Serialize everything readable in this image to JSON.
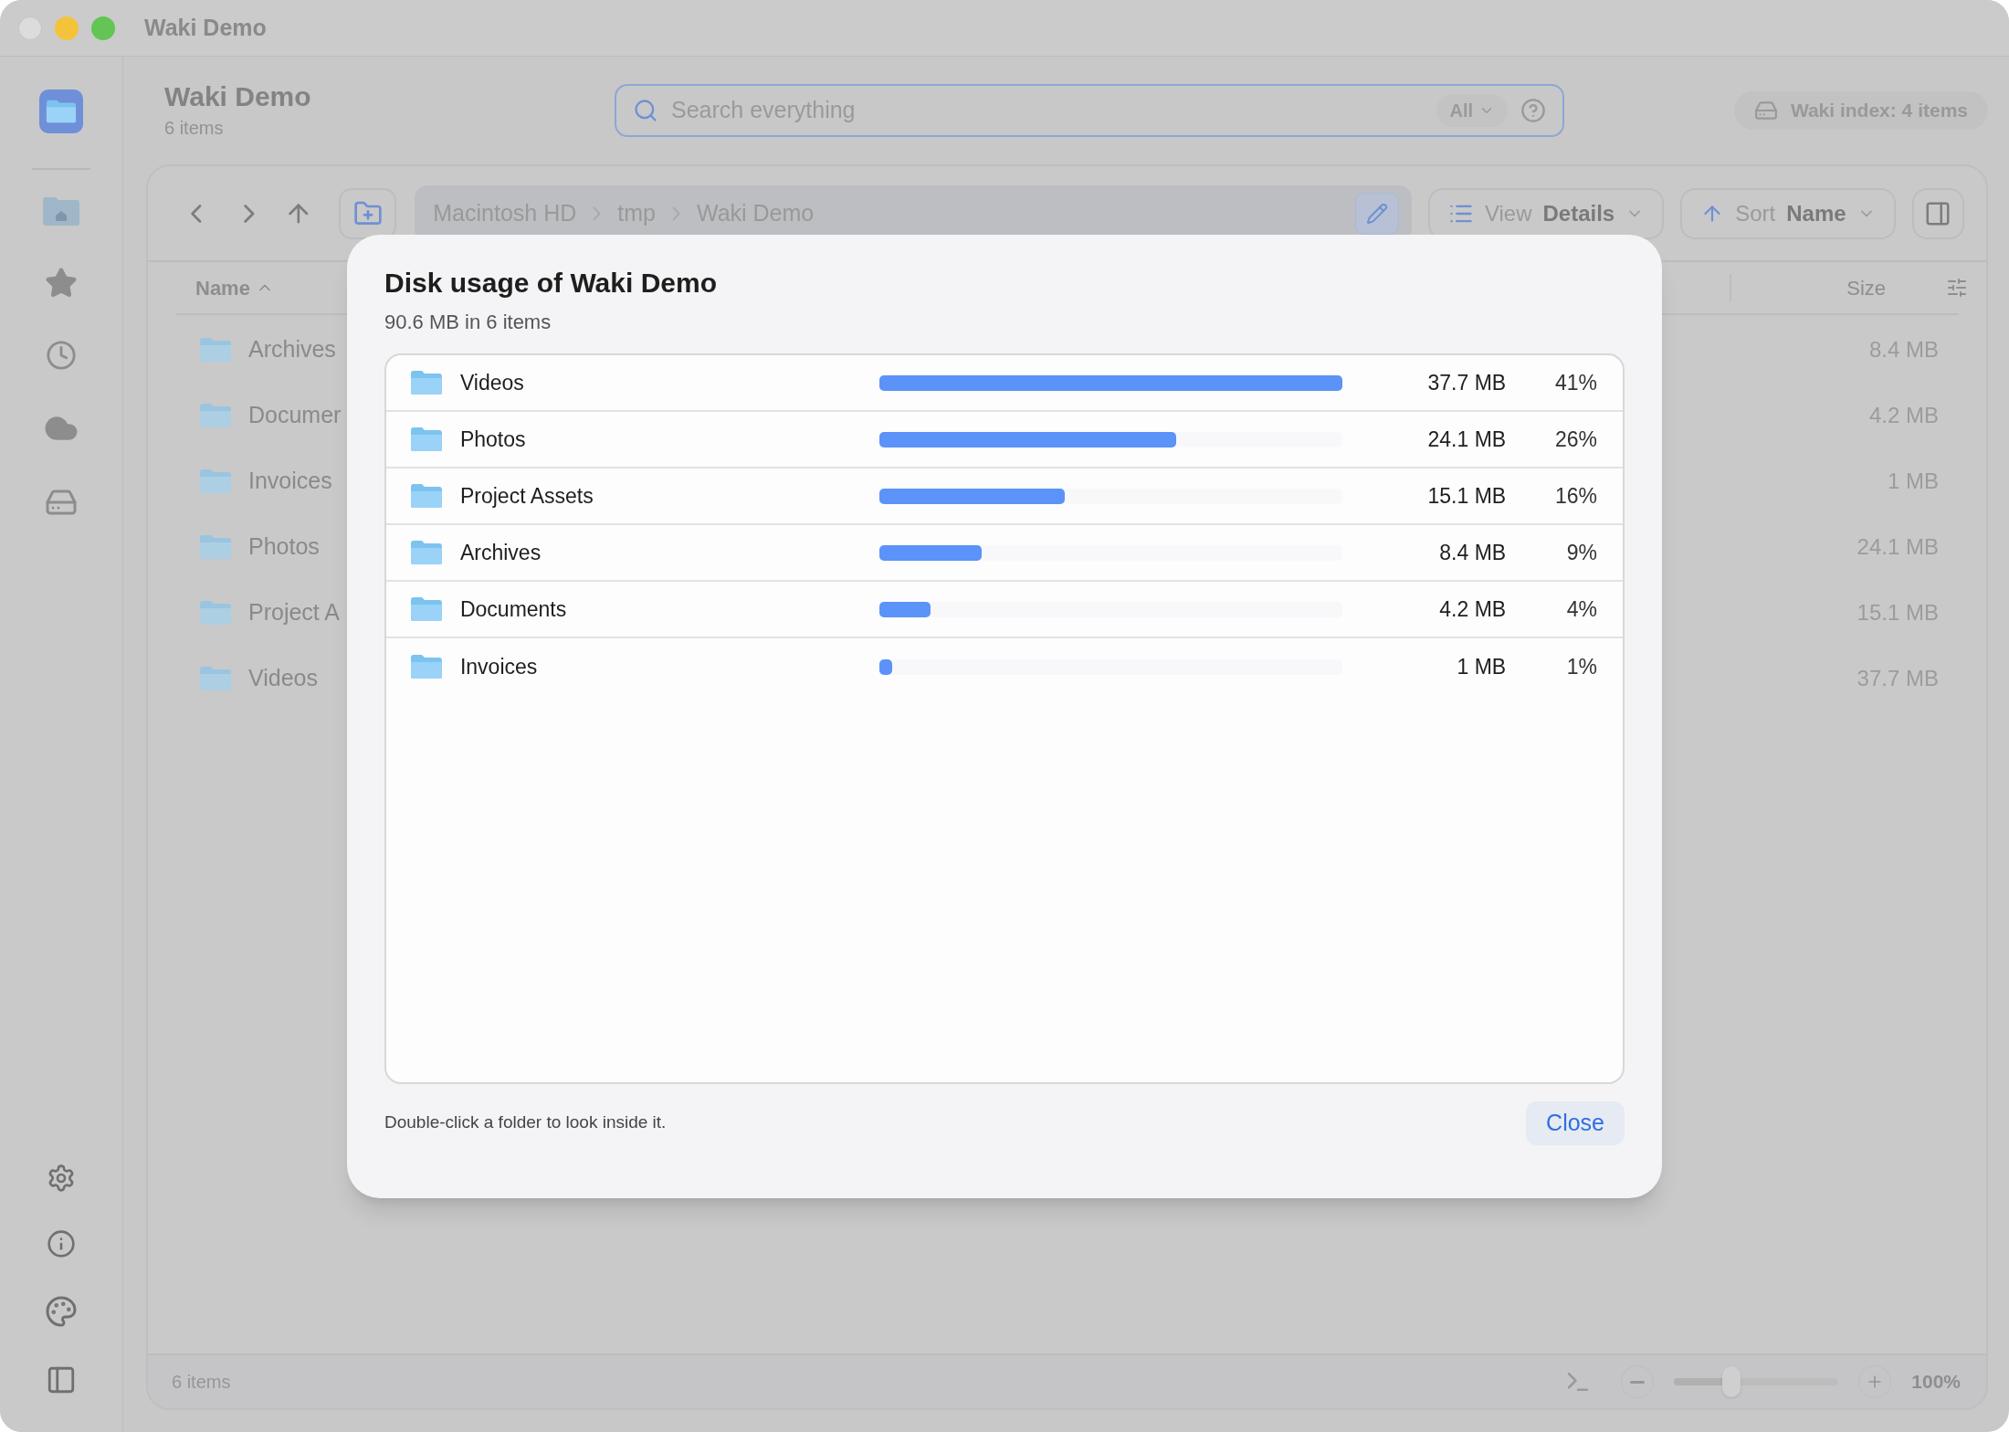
{
  "window": {
    "title": "Waki Demo"
  },
  "header": {
    "title": "Waki Demo",
    "subtitle": "6 items"
  },
  "search": {
    "placeholder": "Search everything",
    "scope": "All"
  },
  "index_badge": "Waki index: 4 items",
  "breadcrumb": [
    "Macintosh HD",
    "tmp",
    "Waki Demo"
  ],
  "view_button": {
    "label": "View",
    "value": "Details"
  },
  "sort_button": {
    "label": "Sort",
    "value": "Name"
  },
  "file_list": {
    "columns": [
      "Name",
      "Size"
    ],
    "rows": [
      {
        "name": "Archives",
        "size": "8.4 MB"
      },
      {
        "name": "Documer",
        "size": "4.2 MB"
      },
      {
        "name": "Invoices",
        "size": "1 MB"
      },
      {
        "name": "Photos",
        "size": "24.1 MB"
      },
      {
        "name": "Project A",
        "size": "15.1 MB"
      },
      {
        "name": "Videos",
        "size": "37.7 MB"
      }
    ]
  },
  "status_bar": {
    "count": "6 items",
    "zoom": {
      "level": 0.35
    },
    "zoom_label": "100%"
  },
  "dialog": {
    "title": "Disk usage of Waki Demo",
    "subtitle": "90.6 MB in 6 items",
    "rows": [
      {
        "name": "Videos",
        "level": 1,
        "size": "37.7 MB",
        "percent": "41%"
      },
      {
        "name": "Photos",
        "level": 0.64,
        "size": "24.1 MB",
        "percent": "26%"
      },
      {
        "name": "Project Assets",
        "level": 0.4,
        "size": "15.1 MB",
        "percent": "16%"
      },
      {
        "name": "Archives",
        "level": 0.22,
        "size": "8.4 MB",
        "percent": "9%"
      },
      {
        "name": "Documents",
        "level": 0.11,
        "size": "4.2 MB",
        "percent": "4%"
      },
      {
        "name": "Invoices",
        "level": 0.027,
        "size": "1 MB",
        "percent": "1%"
      }
    ],
    "hint": "Double-click a folder to look inside it.",
    "close": "Close"
  }
}
